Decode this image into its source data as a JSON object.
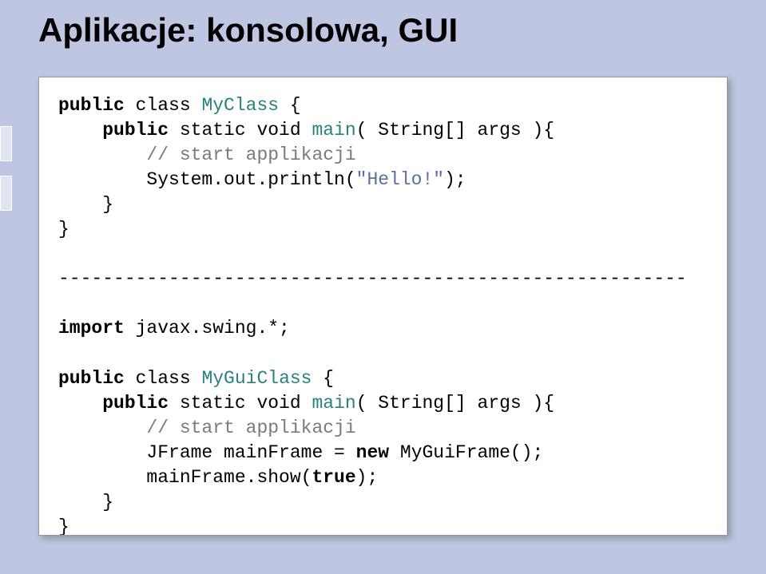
{
  "title": "Aplikacje: konsolowa, GUI",
  "code": {
    "l01a": "public",
    "l01b": " class ",
    "l01c": "MyClass",
    "l01d": " {",
    "l02a": "    public",
    "l02b": " static void ",
    "l02c": "main",
    "l02d": "( String[] args ){",
    "l03a": "        ",
    "l03b": "// start applikacji",
    "l04a": "        System.out.println(",
    "l04b": "\"Hello!\"",
    "l04c": ");",
    "l05": "    }",
    "l06": "}",
    "sep": "---------------------------------------------------------",
    "l08a": "import",
    "l08b": " javax.swing.*;",
    "l10a": "public",
    "l10b": " class ",
    "l10c": "MyGuiClass",
    "l10d": " {",
    "l11a": "    public",
    "l11b": " static void ",
    "l11c": "main",
    "l11d": "( String[] args ){",
    "l12a": "        ",
    "l12b": "// start applikacji",
    "l13a": "        JFrame mainFrame = ",
    "l13b": "new",
    "l13c": " MyGuiFrame();",
    "l14a": "        mainFrame.show(",
    "l14b": "true",
    "l14c": ");",
    "l15": "    }",
    "l16": "}"
  }
}
